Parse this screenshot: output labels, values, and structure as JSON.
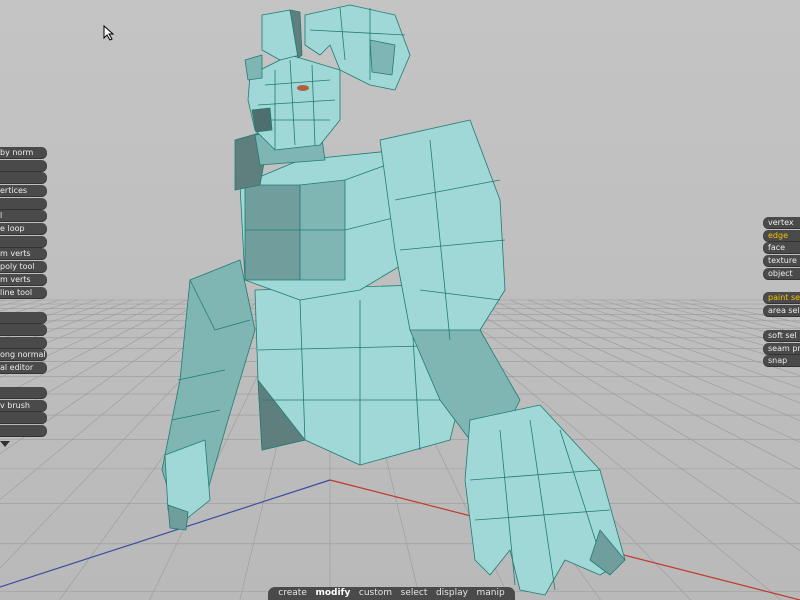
{
  "left_toolbar": {
    "items": [
      {
        "label": "by norm"
      },
      {
        "label": ""
      },
      {
        "label": ""
      },
      {
        "label": "ertices"
      },
      {
        "label": ""
      },
      {
        "label": "l"
      },
      {
        "label": "e loop"
      },
      {
        "label": ""
      },
      {
        "label": "m verts"
      },
      {
        "label": "poly tool"
      },
      {
        "label": "m verts"
      },
      {
        "label": "line tool"
      },
      {
        "label": ""
      },
      {
        "label": ""
      },
      {
        "label": ""
      },
      {
        "label": "ong normal"
      },
      {
        "label": "al editor"
      },
      {
        "label": ""
      },
      {
        "label": "v brush"
      },
      {
        "label": ""
      },
      {
        "label": ""
      },
      {
        "label": "tract"
      }
    ]
  },
  "right_toolbar": {
    "selection_modes": [
      {
        "label": "vertex",
        "active": false
      },
      {
        "label": "edge",
        "active": true
      },
      {
        "label": "face",
        "active": false
      },
      {
        "label": "texture",
        "active": false
      },
      {
        "label": "object",
        "active": false
      }
    ],
    "select_tools": [
      {
        "label": "paint sel",
        "active": true
      },
      {
        "label": "area sel",
        "active": false
      }
    ],
    "options": [
      {
        "label": "soft sel",
        "active": false
      },
      {
        "label": "seam pro",
        "active": false
      },
      {
        "label": "snap",
        "active": false
      }
    ]
  },
  "bottom_menu": {
    "items": [
      {
        "label": "create",
        "active": false
      },
      {
        "label": "modify",
        "active": true
      },
      {
        "label": "custom",
        "active": false
      },
      {
        "label": "select",
        "active": false
      },
      {
        "label": "display",
        "active": false
      },
      {
        "label": "manip",
        "active": false
      }
    ]
  },
  "colors": {
    "background": "#bdbdbd",
    "grid_line": "#9a9a9a",
    "axis_x": "#c0392b",
    "axis_z": "#3a4ea0",
    "mesh_light": "#9fd8d6",
    "mesh_mid": "#7fb6b4",
    "mesh_dark": "#5f7f7e",
    "wire": "#1f7c73",
    "panel": "#4a4a4a",
    "accent": "#f5c400"
  },
  "icons": {
    "cursor": "arrow-cursor-icon",
    "more": "chevron-down-icon"
  }
}
